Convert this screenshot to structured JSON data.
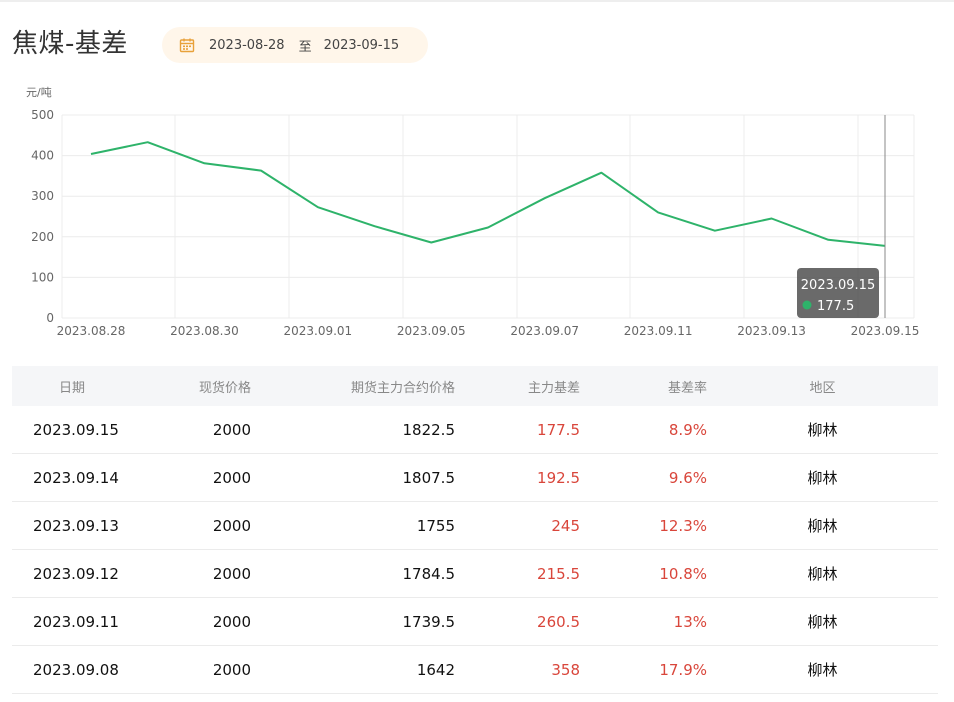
{
  "page_title": "焦煤-基差",
  "date_range": {
    "start": "2023-08-28",
    "separator": "至",
    "end": "2023-09-15"
  },
  "chart_data": {
    "type": "line",
    "unit_label": "元/吨",
    "y_range": [
      0,
      500
    ],
    "y_ticks": [
      0,
      100,
      200,
      300,
      400,
      500
    ],
    "x_tick_labels": [
      "2023.08.28",
      "2023.08.30",
      "2023.09.01",
      "2023.09.05",
      "2023.09.07",
      "2023.09.11",
      "2023.09.13",
      "2023.09.15"
    ],
    "x_tick_positions": [
      0,
      2,
      4,
      6,
      8,
      10,
      12,
      14
    ],
    "series": [
      {
        "values": [
          404,
          433,
          381,
          363,
          273,
          226,
          186,
          223,
          295,
          358,
          260,
          215,
          245,
          192.5,
          177.5
        ]
      }
    ],
    "line_color": "#2eb36a",
    "grid": true,
    "tooltip": {
      "date": "2023.09.15",
      "value": "177.5",
      "index": 14
    }
  },
  "table": {
    "headers": [
      "日期",
      "现货价格",
      "期货主力合约价格",
      "主力基差",
      "基差率",
      "地区"
    ],
    "rows": [
      [
        "2023.09.15",
        "2000",
        "1822.5",
        "177.5",
        "8.9%",
        "柳林"
      ],
      [
        "2023.09.14",
        "2000",
        "1807.5",
        "192.5",
        "9.6%",
        "柳林"
      ],
      [
        "2023.09.13",
        "2000",
        "1755",
        "245",
        "12.3%",
        "柳林"
      ],
      [
        "2023.09.12",
        "2000",
        "1784.5",
        "215.5",
        "10.8%",
        "柳林"
      ],
      [
        "2023.09.11",
        "2000",
        "1739.5",
        "260.5",
        "13%",
        "柳林"
      ],
      [
        "2023.09.08",
        "2000",
        "1642",
        "358",
        "17.9%",
        "柳林"
      ]
    ],
    "accent_color": "#d9463b"
  }
}
